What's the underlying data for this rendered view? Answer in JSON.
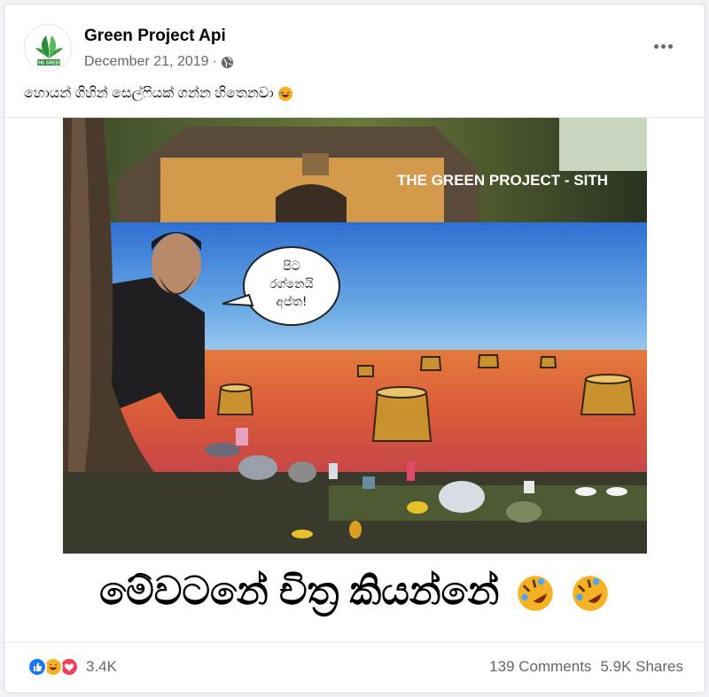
{
  "post": {
    "page_name": "Green Project Api",
    "date": "December 21, 2019",
    "date_separator": "·",
    "caption": "හොයන් ගිහින් සෙල්ෆියක් ගන්න හිතෙනවා",
    "avatar_text": "THE GREEN",
    "image": {
      "watermark": "THE GREEN PROJECT - SITH",
      "speech_bubble": [
        "පිට",
        "රග්නෙයි",
        "අප්ත!"
      ]
    },
    "bottom_text": "මේවටනේ චිත්‍ර කියන්නේ"
  },
  "footer": {
    "reaction_count": "3.4K",
    "comments": "139 Comments",
    "shares": "5.9K Shares"
  },
  "colors": {
    "like": "#1877f2",
    "haha": "#f7b125",
    "love": "#f33e58",
    "brand_green": "#2e8b3a"
  },
  "icons": {
    "avatar": "green-leaf-logo-icon",
    "globe": "globe-icon",
    "more": "more-options-icon",
    "caption_emoji": "laughing-emoji-icon",
    "like": "like-icon",
    "haha": "haha-icon",
    "love": "love-icon"
  }
}
